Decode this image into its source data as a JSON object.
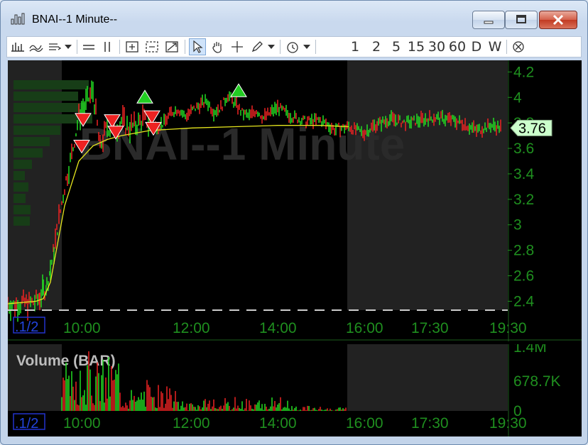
{
  "window": {
    "title": "BNAI--1 Minute--",
    "buttons": {
      "minimize": "minimize",
      "maximize": "maximize",
      "close": "close"
    }
  },
  "toolbar": {
    "interval_buttons": [
      "1",
      "2",
      "5",
      "15",
      "30",
      "60",
      "D",
      "W"
    ]
  },
  "chart": {
    "watermark": "BNAI--1 Minute",
    "zoom_label": ".1/2",
    "last_price_label": "3.76",
    "colors": {
      "up": "#22dd22",
      "down": "#ee2222",
      "vwap": "#e6e61e",
      "axis_text": "#1f8f1f",
      "extended_bg": "#222222",
      "dashed_line": "#cccccc"
    }
  },
  "chart_data": [
    {
      "type": "line",
      "title": "",
      "x_tick_labels": [
        "10:00",
        "12:00",
        "14:00",
        "16:00",
        "17:30",
        "19:30"
      ],
      "y_tick_labels": [
        "4.2",
        "4",
        "3.8",
        "3.6",
        "3.4",
        "3.2",
        "3",
        "2.8",
        "2.6",
        "2.4"
      ],
      "ylim": [
        2.33,
        4.28
      ],
      "last_price": 3.76,
      "series": [
        {
          "x": [
            0,
            10,
            20,
            30,
            40,
            45,
            50,
            55,
            60,
            65,
            70,
            80,
            90,
            100,
            110,
            120,
            130,
            140,
            150,
            160,
            170,
            180,
            190,
            200,
            210,
            220,
            230,
            240,
            250,
            260,
            270,
            280,
            290,
            300,
            310,
            320,
            330,
            340,
            350,
            360,
            380,
            400,
            420,
            440,
            460,
            480,
            500,
            520,
            540,
            560,
            580,
            600,
            620,
            640,
            660,
            680,
            696
          ],
          "values": [
            2.38,
            2.37,
            2.39,
            2.38,
            2.4,
            2.43,
            2.48,
            2.53,
            2.65,
            2.8,
            2.98,
            3.3,
            3.55,
            3.85,
            3.95,
            4.05,
            3.6,
            3.78,
            3.73,
            3.82,
            3.76,
            3.78,
            3.83,
            3.79,
            3.77,
            3.8,
            3.88,
            3.91,
            3.85,
            3.9,
            3.94,
            3.97,
            3.89,
            3.92,
            4.02,
            3.95,
            3.88,
            3.85,
            3.9,
            3.84,
            3.92,
            3.85,
            3.81,
            3.82,
            3.75,
            3.77,
            3.72,
            3.79,
            3.83,
            3.8,
            3.82,
            3.84,
            3.83,
            3.8,
            3.74,
            3.78,
            3.76
          ]
        },
        {
          "x": [
            0,
            20,
            40,
            50,
            60,
            70,
            80,
            100,
            120,
            140,
            160,
            200,
            260,
            320,
            380,
            440,
            480
          ],
          "values": [
            2.38,
            2.39,
            2.4,
            2.42,
            2.55,
            2.85,
            3.15,
            3.5,
            3.62,
            3.67,
            3.7,
            3.74,
            3.76,
            3.77,
            3.78,
            3.78,
            3.77
          ]
        }
      ],
      "markers": [
        {
          "type": "buy",
          "x": 193,
          "price": 4.0
        },
        {
          "type": "buy",
          "x": 325,
          "price": 4.05
        },
        {
          "type": "sell",
          "x": 106,
          "price": 3.83
        },
        {
          "type": "sell",
          "x": 104,
          "price": 3.62
        },
        {
          "type": "sell",
          "x": 147,
          "price": 3.82
        },
        {
          "type": "sell",
          "x": 152,
          "price": 3.73
        },
        {
          "type": "sell",
          "x": 203,
          "price": 3.85
        },
        {
          "type": "sell",
          "x": 205,
          "price": 3.76
        }
      ]
    },
    {
      "type": "bar",
      "title": "Volume (BAR)",
      "x_tick_labels": [
        "10:00",
        "12:00",
        "14:00",
        "16:00",
        "17:30",
        "19:30"
      ],
      "y_tick_labels": [
        "1.4M",
        "678.7K",
        "0"
      ],
      "ylim": [
        0,
        1400000
      ]
    }
  ]
}
